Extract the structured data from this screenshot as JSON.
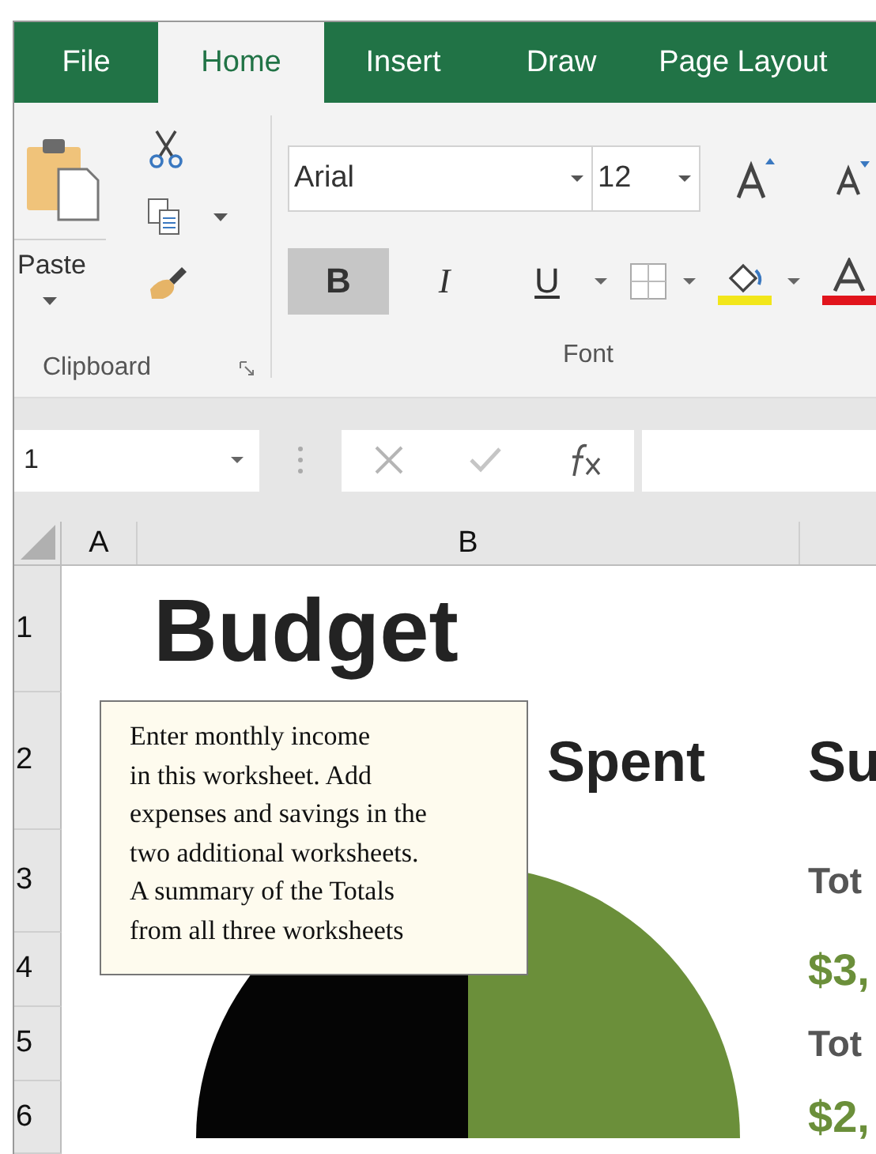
{
  "tabs": [
    {
      "label": "File",
      "selected": false
    },
    {
      "label": "Home",
      "selected": true
    },
    {
      "label": "Insert",
      "selected": false
    },
    {
      "label": "Draw",
      "selected": false
    },
    {
      "label": "Page Layout",
      "selected": false
    }
  ],
  "clipboard": {
    "paste_label": "Paste",
    "group_label": "Clipboard"
  },
  "font": {
    "font_name": "Arial",
    "font_size": "12",
    "bold_label": "B",
    "italic_label": "I",
    "underline_label": "U",
    "bold_on": true,
    "italic_on": false,
    "underline_on": false,
    "group_label": "Font"
  },
  "formula_bar": {
    "name_box": "1"
  },
  "columns": [
    "A",
    "B"
  ],
  "rows": [
    {
      "header": "1",
      "b": "Budget"
    },
    {
      "header": "2",
      "b": "Spent",
      "c": "Su",
      "kind": "heading"
    },
    {
      "header": "3",
      "c": "Tot",
      "kind": "label"
    },
    {
      "header": "4",
      "c": "$3,",
      "kind": "amount"
    },
    {
      "header": "5",
      "c": "Tot",
      "kind": "label"
    },
    {
      "header": "6",
      "c": "$2,",
      "kind": "amount"
    }
  ],
  "comment": {
    "text": "Enter monthly income\nin this worksheet. Add\nexpenses and savings in the\ntwo additional worksheets.\nA summary of the Totals\nfrom all three worksheets"
  }
}
